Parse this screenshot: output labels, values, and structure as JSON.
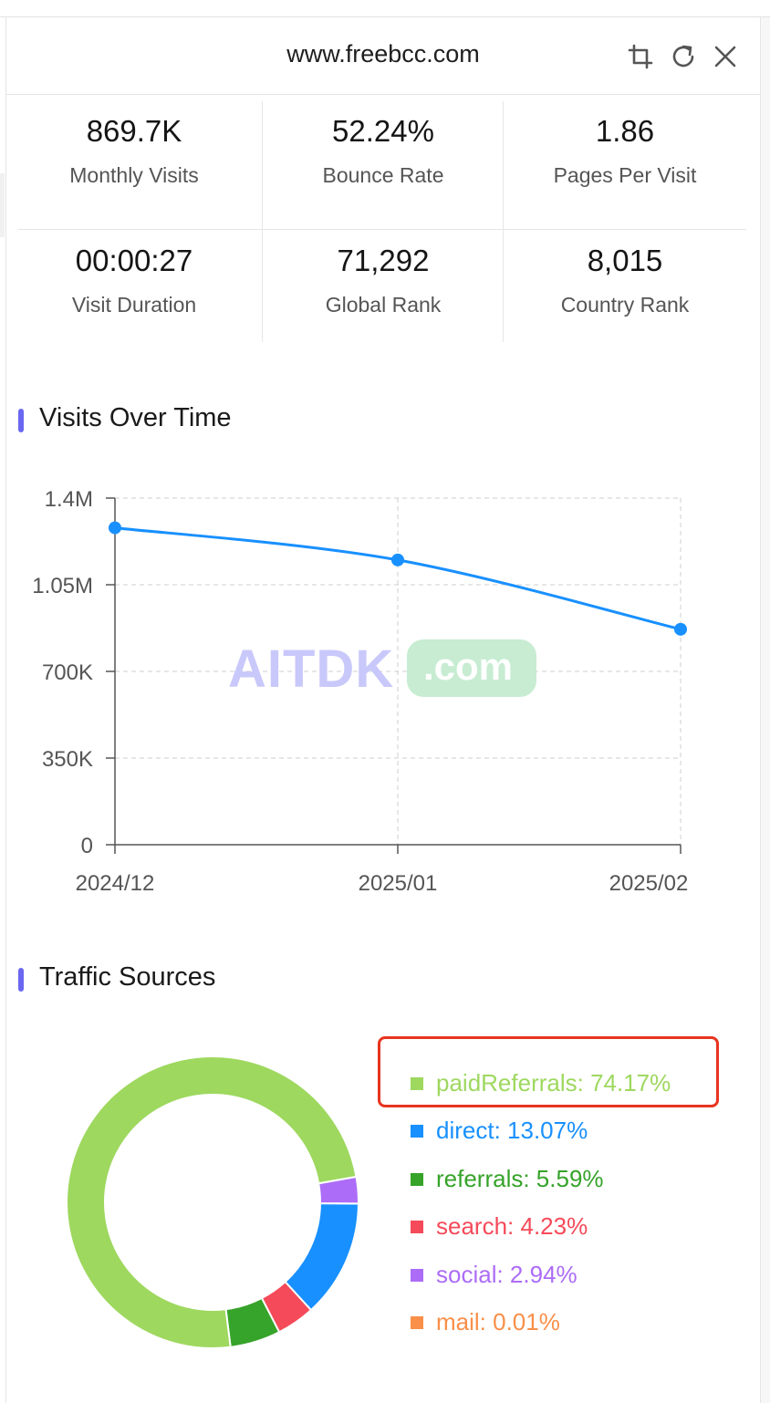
{
  "header": {
    "title": "www.freebcc.com",
    "icons": [
      "crop-icon",
      "refresh-icon",
      "close-icon"
    ]
  },
  "stats": [
    {
      "value": "869.7K",
      "label": "Monthly Visits"
    },
    {
      "value": "52.24%",
      "label": "Bounce Rate"
    },
    {
      "value": "1.86",
      "label": "Pages Per Visit"
    },
    {
      "value": "00:00:27",
      "label": "Visit Duration"
    },
    {
      "value": "71,292",
      "label": "Global Rank"
    },
    {
      "value": "8,015",
      "label": "Country Rank"
    }
  ],
  "visits_section": {
    "title": "Visits Over Time"
  },
  "traffic_section": {
    "title": "Traffic Sources"
  },
  "watermark": {
    "left": "AITDK",
    "right": ".com"
  },
  "colors": {
    "accent": "#6a67f1",
    "line": "#1890ff",
    "paidReferrals": "#9ed85f",
    "direct": "#1890ff",
    "referrals": "#36a32a",
    "search": "#f54a59",
    "social": "#ac6cf7",
    "mail": "#f98f49"
  },
  "chart_data": [
    {
      "type": "line",
      "title": "Visits Over Time",
      "x": [
        "2024/12",
        "2025/01",
        "2025/02"
      ],
      "y_tick_labels": [
        "0",
        "350K",
        "700K",
        "1.05M",
        "1.4M"
      ],
      "ylim": [
        0,
        1400000
      ],
      "grid": true,
      "series": [
        {
          "values": [
            1280000,
            1150000,
            870000
          ]
        }
      ]
    },
    {
      "type": "pie",
      "title": "Traffic Sources",
      "legend_position": "right",
      "slices": [
        {
          "name": "paidReferrals",
          "value": 74.17,
          "label": "paidReferrals: 74.17%"
        },
        {
          "name": "direct",
          "value": 13.07,
          "label": "direct: 13.07%"
        },
        {
          "name": "referrals",
          "value": 5.59,
          "label": "referrals: 5.59%"
        },
        {
          "name": "search",
          "value": 4.23,
          "label": "search: 4.23%"
        },
        {
          "name": "social",
          "value": 2.94,
          "label": "social: 2.94%"
        },
        {
          "name": "mail",
          "value": 0.01,
          "label": "mail: 0.01%"
        }
      ]
    }
  ]
}
